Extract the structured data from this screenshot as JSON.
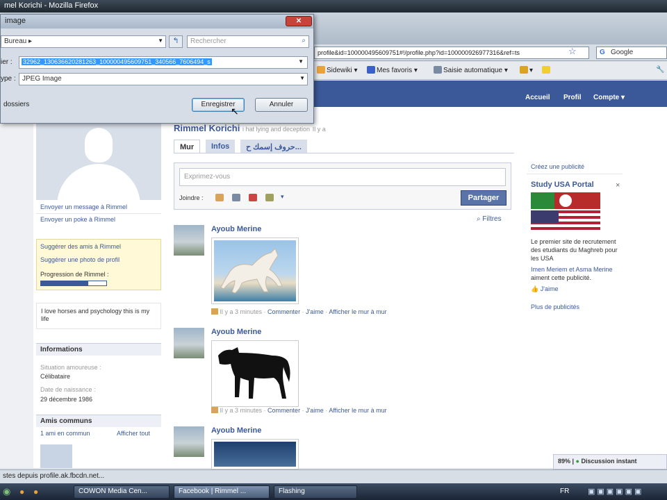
{
  "window": {
    "title": "mel Korichi - Mozilla Firefox"
  },
  "navbar": {
    "url": "profile&id=100000495609751#!/profile.php?id=100000926977316&ref=ts",
    "search_engine": "Google"
  },
  "bookmarks": [
    "Sidewiki",
    "Mes favoris",
    "Saisie automatique"
  ],
  "fb_nav": {
    "home": "Accueil",
    "profile": "Profil",
    "account": "Compte"
  },
  "dialog": {
    "title": "image",
    "location": "Bureau",
    "search_placeholder": "Rechercher",
    "filename_label": "ier :",
    "filename": "32962_130636620281263_100000495609751_340566_7606494_s",
    "filetype_label": "ype :",
    "filetype": "JPEG Image",
    "folders": "dossiers",
    "save_label": "Enregistrer",
    "cancel_label": "Annuler"
  },
  "profile": {
    "name": "Rimmel Korichi",
    "tagline": "i hat lying and deception",
    "tagline_suffix": "Il y a",
    "tabs": [
      "Mur",
      "Infos",
      "حروف إسمك ح..."
    ],
    "send_message": "Envoyer un message à Rimmel",
    "send_poke": "Envoyer un poke à Rimmel",
    "suggest_friends": "Suggérer des amis à Rimmel",
    "suggest_photo": "Suggérer une photo de profil",
    "progress_label": "Progression de Rimmel :",
    "progress": 0.72,
    "bio": "I love horses and psychology this is my life",
    "info_header": "Informations",
    "relationship_label": "Situation amoureuse :",
    "relationship": "Célibataire",
    "birthday_label": "Date de naissance :",
    "birthday": "29 décembre 1986",
    "mutual_header": "Amis communs",
    "mutual_count": "1 ami en commun",
    "show_all": "Afficher tout"
  },
  "composer": {
    "placeholder": "Exprimez-vous",
    "attach_label": "Joindre :",
    "share_label": "Partager",
    "filters": "Filtres"
  },
  "posts": [
    {
      "author": "Ayoub Merine",
      "time": "Il y a 3 minutes",
      "comment": "Commenter",
      "like": "J'aime",
      "wall": "Afficher le mur à mur"
    },
    {
      "author": "Ayoub Merine",
      "time": "Il y a 3 minutes",
      "comment": "Commenter",
      "like": "J'aime",
      "wall": "Afficher le mur à mur"
    },
    {
      "author": "Ayoub Merine"
    }
  ],
  "ads": {
    "create": "Créez une publicité",
    "title": "Study USA Portal",
    "close": "×",
    "text": "Le premier site de recrutement des etudiants du Maghreb pour les USA",
    "likers": "Imen Meriem et Asma Merine",
    "likers_suffix": "aiment cette publicité.",
    "like": "J'aime",
    "more": "Plus de publicités"
  },
  "chat": {
    "zoom": "89%",
    "label": "Discussion instant"
  },
  "statusbar": {
    "text": "stes depuis profile.ak.fbcdn.net..."
  },
  "taskbar": {
    "tasks": [
      "COWON Media Cen...",
      "Facebook | Rimmel ...",
      "Flashing"
    ],
    "lang": "FR"
  },
  "colors": {
    "fb_blue": "#3b5998",
    "accent_yellow": "#fff9d7"
  }
}
